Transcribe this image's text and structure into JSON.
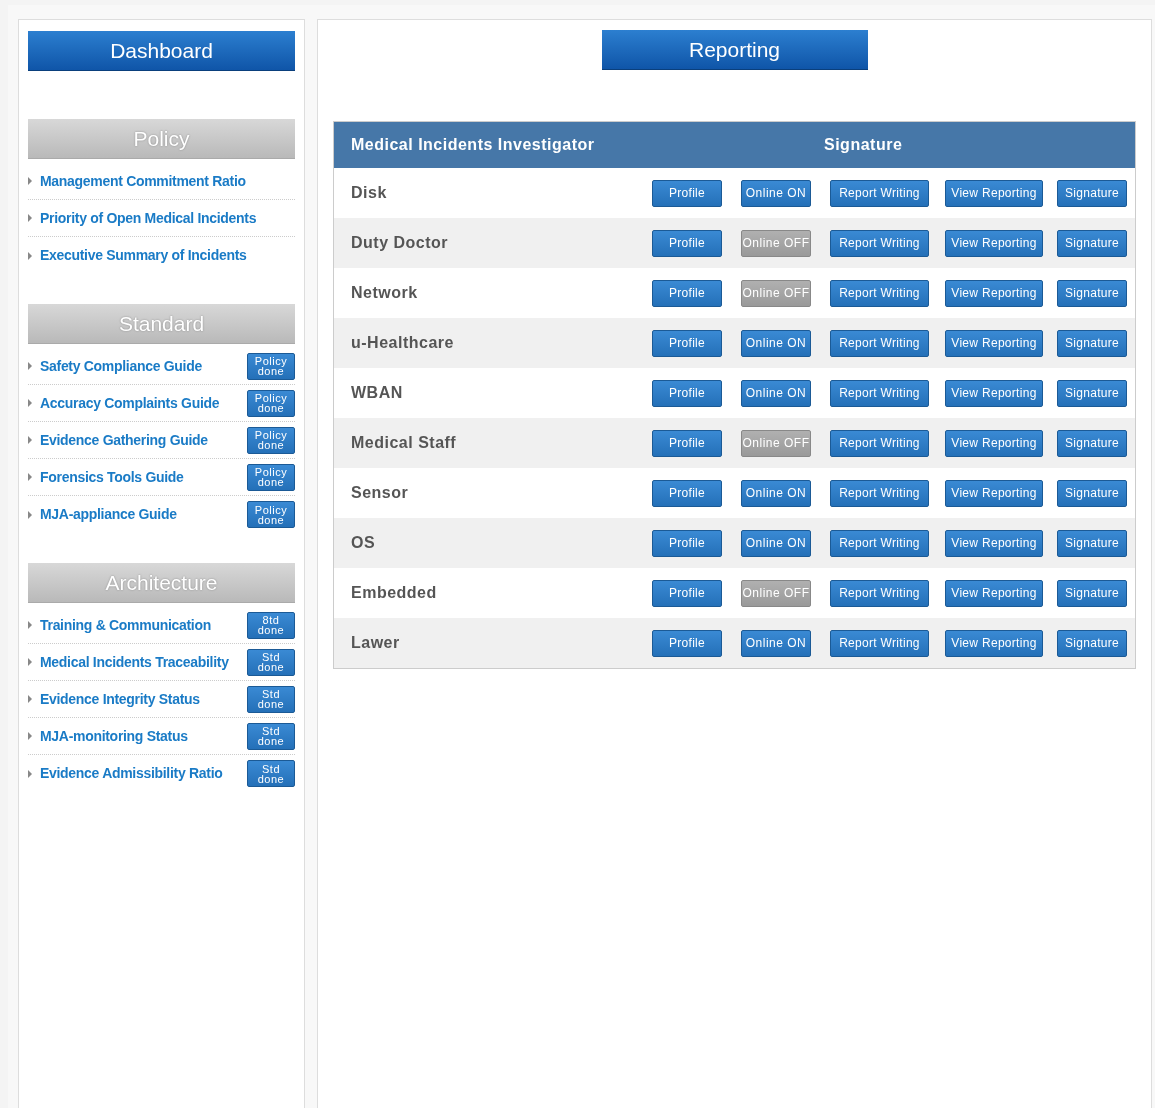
{
  "sidebar": {
    "title": "Dashboard",
    "sections": [
      {
        "title": "Policy",
        "items": [
          {
            "label": "Management Commitment Ratio"
          },
          {
            "label": "Priority of Open Medical Incidents"
          },
          {
            "label": "Executive Summary of Incidents"
          }
        ]
      },
      {
        "title": "Standard",
        "items": [
          {
            "label": "Safety Compliance Guide",
            "badge": [
              "Policy",
              "done"
            ]
          },
          {
            "label": "Accuracy Complaints Guide",
            "badge": [
              "Policy",
              "done"
            ]
          },
          {
            "label": "Evidence Gathering Guide",
            "badge": [
              "Policy",
              "done"
            ]
          },
          {
            "label": "Forensics Tools Guide",
            "badge": [
              "Policy",
              "done"
            ]
          },
          {
            "label": "MJA-appliance Guide",
            "badge": [
              "Policy",
              "done"
            ]
          }
        ]
      },
      {
        "title": "Architecture",
        "items": [
          {
            "label": "Training & Communication",
            "badge": [
              "8td",
              "done"
            ]
          },
          {
            "label": "Medical Incidents Traceability",
            "badge": [
              "Std",
              "done"
            ]
          },
          {
            "label": "Evidence Integrity Status",
            "badge": [
              "Std",
              "done"
            ]
          },
          {
            "label": "MJA-monitoring Status",
            "badge": [
              "Std",
              "done"
            ]
          },
          {
            "label": "Evidence Admissibility Ratio",
            "badge": [
              "Std",
              "done"
            ]
          }
        ]
      }
    ]
  },
  "main": {
    "title": "Reporting",
    "table": {
      "columns": [
        "Medical Incidents Investigator",
        "Signature"
      ],
      "rows": [
        {
          "name": "Disk",
          "actions": [
            {
              "kind": "button",
              "label": "Profile"
            },
            {
              "kind": "toggle",
              "label": "Online ON",
              "on": true
            },
            {
              "kind": "button",
              "label": "Report Writing"
            },
            {
              "kind": "button",
              "label": "View Reporting"
            },
            {
              "kind": "button",
              "label": "Signature"
            }
          ]
        },
        {
          "name": "Duty Doctor",
          "actions": [
            {
              "kind": "button",
              "label": "Profile"
            },
            {
              "kind": "toggle",
              "label": "Online OFF",
              "on": false
            },
            {
              "kind": "button",
              "label": "Report Writing"
            },
            {
              "kind": "button",
              "label": "View Reporting"
            },
            {
              "kind": "button",
              "label": "Signature"
            }
          ]
        },
        {
          "name": "Network",
          "actions": [
            {
              "kind": "button",
              "label": "Profile"
            },
            {
              "kind": "toggle",
              "label": "Online OFF",
              "on": false
            },
            {
              "kind": "button",
              "label": "Report Writing"
            },
            {
              "kind": "button",
              "label": "View Reporting"
            },
            {
              "kind": "button",
              "label": "Signature"
            }
          ]
        },
        {
          "name": "u-Healthcare",
          "actions": [
            {
              "kind": "button",
              "label": "Profile"
            },
            {
              "kind": "toggle",
              "label": "Online ON",
              "on": true
            },
            {
              "kind": "button",
              "label": "Report Writing"
            },
            {
              "kind": "button",
              "label": "View Reporting"
            },
            {
              "kind": "button",
              "label": "Signature"
            }
          ]
        },
        {
          "name": "WBAN",
          "actions": [
            {
              "kind": "button",
              "label": "Profile"
            },
            {
              "kind": "toggle",
              "label": "Online ON",
              "on": true
            },
            {
              "kind": "button",
              "label": "Report Writing"
            },
            {
              "kind": "button",
              "label": "View Reporting"
            },
            {
              "kind": "button",
              "label": "Signature"
            }
          ]
        },
        {
          "name": "Medical Staff",
          "actions": [
            {
              "kind": "button",
              "label": "Profile"
            },
            {
              "kind": "toggle",
              "label": "Online OFF",
              "on": false
            },
            {
              "kind": "button",
              "label": "Report Writing"
            },
            {
              "kind": "button",
              "label": "View Reporting"
            },
            {
              "kind": "button",
              "label": "Signature"
            }
          ]
        },
        {
          "name": "Sensor",
          "actions": [
            {
              "kind": "button",
              "label": "Profile"
            },
            {
              "kind": "toggle",
              "label": "Online ON",
              "on": true
            },
            {
              "kind": "button",
              "label": "Report Writing"
            },
            {
              "kind": "button",
              "label": "View Reporting"
            },
            {
              "kind": "button",
              "label": "Signature"
            }
          ]
        },
        {
          "name": "OS",
          "actions": [
            {
              "kind": "button",
              "label": "Profile"
            },
            {
              "kind": "toggle",
              "label": "Online ON",
              "on": true
            },
            {
              "kind": "button",
              "label": "Report Writing"
            },
            {
              "kind": "button",
              "label": "View Reporting"
            },
            {
              "kind": "button",
              "label": "Signature"
            }
          ]
        },
        {
          "name": "Embedded",
          "actions": [
            {
              "kind": "button",
              "label": "Profile"
            },
            {
              "kind": "toggle",
              "label": "Online OFF",
              "on": false
            },
            {
              "kind": "button",
              "label": "Report Writing"
            },
            {
              "kind": "button",
              "label": "View Reporting"
            },
            {
              "kind": "button",
              "label": "Signature"
            }
          ]
        },
        {
          "name": "Lawer",
          "actions": [
            {
              "kind": "button",
              "label": "Profile"
            },
            {
              "kind": "toggle",
              "label": "Online ON",
              "on": true
            },
            {
              "kind": "button",
              "label": "Report Writing"
            },
            {
              "kind": "button",
              "label": "View Reporting"
            },
            {
              "kind": "button",
              "label": "Signature"
            }
          ]
        }
      ]
    }
  }
}
